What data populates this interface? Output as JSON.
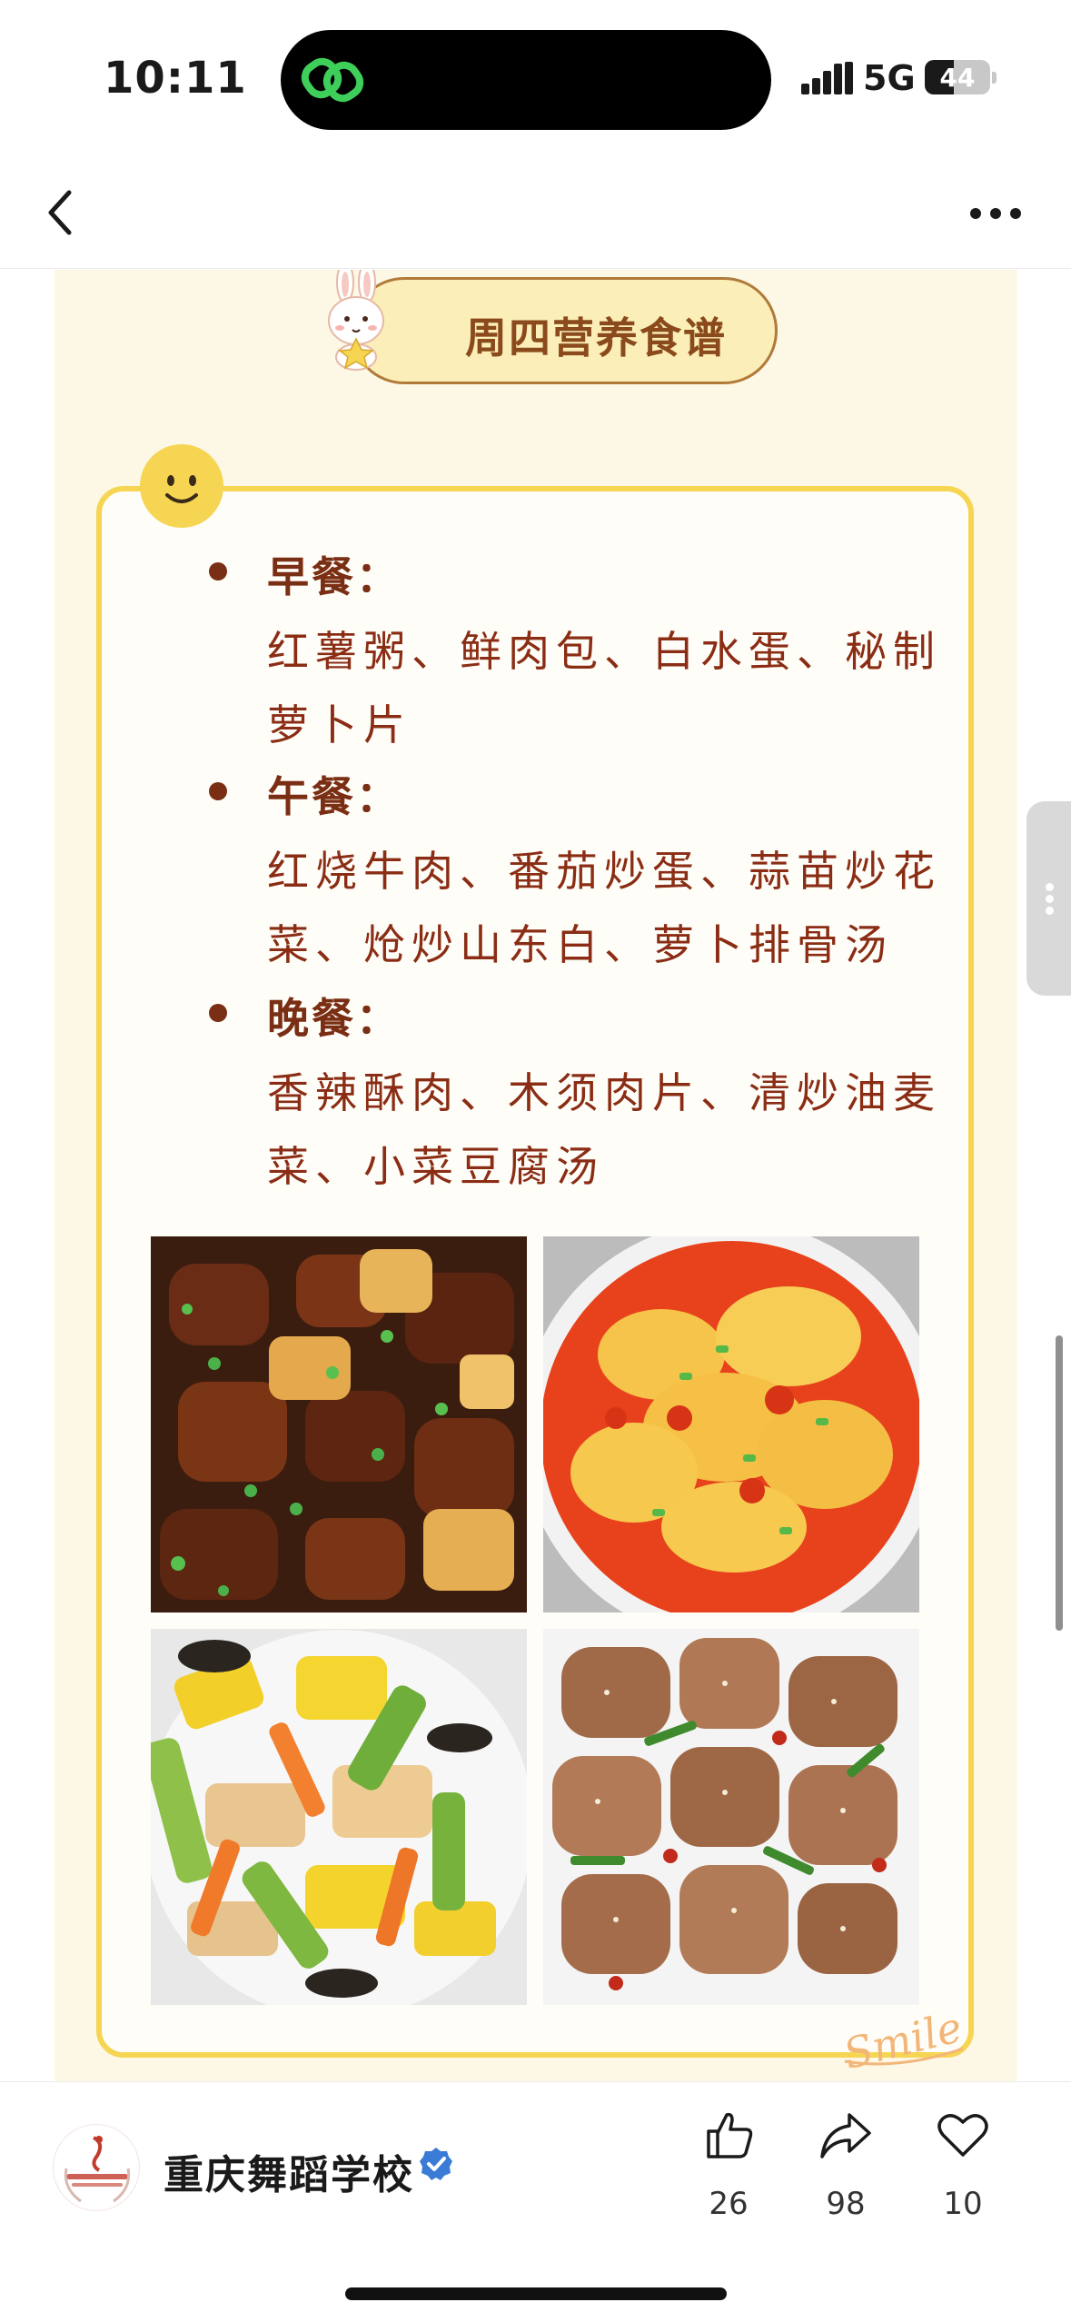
{
  "status_bar": {
    "time": "10:11",
    "network": "5G",
    "battery_level": "44",
    "island_app_icon": "link-icon",
    "island_icon_color": "#3ecf5a"
  },
  "nav": {
    "back_icon": "chevron-left-icon",
    "more_icon": "more-horizontal-icon"
  },
  "poster": {
    "title": "周四营养食谱",
    "title_color": "#8a4a1c",
    "card_border_color": "#f6d553",
    "text_color": "#8a2d14",
    "meals": [
      {
        "label": "早餐：",
        "items": "红薯粥、鲜肉包、白水蛋、秘制萝卜片"
      },
      {
        "label": "午餐：",
        "items": "红烧牛肉、番茄炒蛋、蒜苗炒花菜、炝炒山东白、萝卜排骨汤"
      },
      {
        "label": "晚餐：",
        "items": "香辣酥肉、木须肉片、清炒油麦菜、小菜豆腐汤"
      }
    ],
    "food_photos": [
      {
        "name": "braised-beef-potato-photo"
      },
      {
        "name": "tomato-egg-photo"
      },
      {
        "name": "mushroom-pork-egg-photo"
      },
      {
        "name": "spicy-crispy-pork-photo"
      }
    ],
    "signature": "Smile"
  },
  "bottom_bar": {
    "account_name": "重庆舞蹈学校",
    "verified_color": "#3a7bd5",
    "actions": [
      {
        "icon": "thumbs-up-icon",
        "count": "26"
      },
      {
        "icon": "share-icon",
        "count": "98"
      },
      {
        "icon": "heart-icon",
        "count": "10"
      }
    ]
  }
}
